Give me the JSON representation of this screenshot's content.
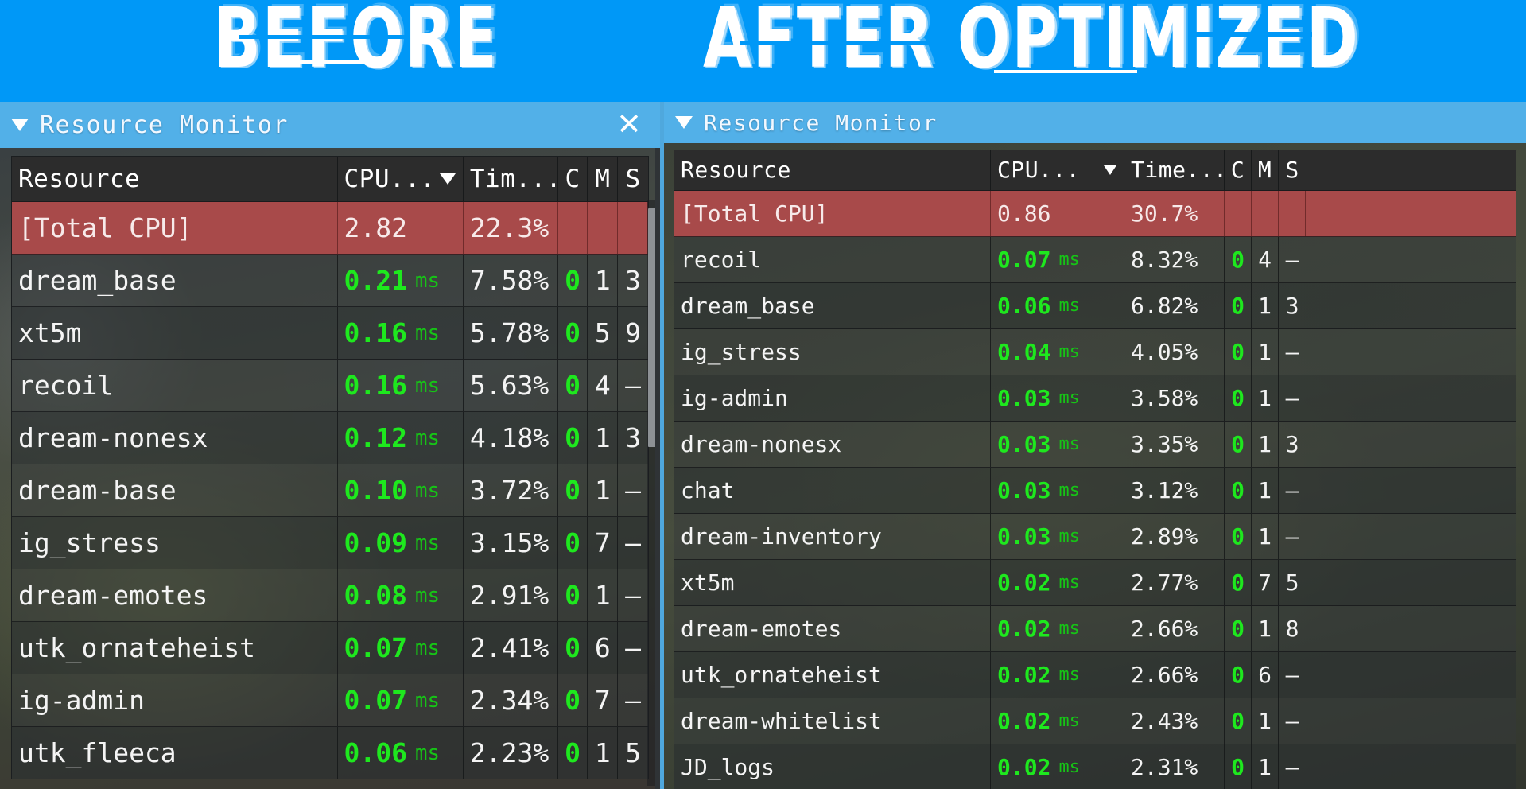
{
  "banner": {
    "left_label": "BEFORE",
    "right_label": "AFTER OPTIMIZED",
    "background_color": "#0098f7",
    "text_color": "#ffffff"
  },
  "colors": {
    "titlebar": "#52b0e8",
    "header_row": "#2c2c2c",
    "total_row": "#a84a4a",
    "ms_green": "#1ee81e",
    "text": "#f4f4f4"
  },
  "panels": {
    "before": {
      "title": "Resource Monitor",
      "collapse_icon": "triangle-down-icon",
      "close_icon": "close-icon",
      "columns": [
        "Resource",
        "CPU...",
        "Tim...",
        "C",
        "M",
        "S"
      ],
      "sorted_column": "CPU...",
      "sort_direction": "descending",
      "rows": [
        {
          "resource": "[Total CPU]",
          "cpu": "2.82",
          "unit": "",
          "time": "22.3%",
          "c": "",
          "m": "",
          "s": "",
          "total": true
        },
        {
          "resource": "dream_base",
          "cpu": "0.21",
          "unit": "ms",
          "time": "7.58%",
          "c": "0",
          "m": "1",
          "s": "3"
        },
        {
          "resource": "xt5m",
          "cpu": "0.16",
          "unit": "ms",
          "time": "5.78%",
          "c": "0",
          "m": "5",
          "s": "9"
        },
        {
          "resource": "recoil",
          "cpu": "0.16",
          "unit": "ms",
          "time": "5.63%",
          "c": "0",
          "m": "4",
          "s": "—"
        },
        {
          "resource": "dream-nonesx",
          "cpu": "0.12",
          "unit": "ms",
          "time": "4.18%",
          "c": "0",
          "m": "1",
          "s": "3"
        },
        {
          "resource": "dream-base",
          "cpu": "0.10",
          "unit": "ms",
          "time": "3.72%",
          "c": "0",
          "m": "1",
          "s": "—"
        },
        {
          "resource": "ig_stress",
          "cpu": "0.09",
          "unit": "ms",
          "time": "3.15%",
          "c": "0",
          "m": "7",
          "s": "—"
        },
        {
          "resource": "dream-emotes",
          "cpu": "0.08",
          "unit": "ms",
          "time": "2.91%",
          "c": "0",
          "m": "1",
          "s": "—"
        },
        {
          "resource": "utk_ornateheist",
          "cpu": "0.07",
          "unit": "ms",
          "time": "2.41%",
          "c": "0",
          "m": "6",
          "s": "—"
        },
        {
          "resource": "ig-admin",
          "cpu": "0.07",
          "unit": "ms",
          "time": "2.34%",
          "c": "0",
          "m": "7",
          "s": "—"
        },
        {
          "resource": "utk_fleeca",
          "cpu": "0.06",
          "unit": "ms",
          "time": "2.23%",
          "c": "0",
          "m": "1",
          "s": "5"
        }
      ]
    },
    "after": {
      "title": "Resource Monitor",
      "collapse_icon": "triangle-down-icon",
      "columns": [
        "Resource",
        "CPU...",
        "Time...",
        "C",
        "M",
        "S"
      ],
      "sorted_column": "CPU...",
      "sort_direction": "descending",
      "rows": [
        {
          "resource": "[Total CPU]",
          "cpu": "0.86",
          "unit": "",
          "time": "30.7%",
          "c": "",
          "m": "",
          "s": "",
          "total": true
        },
        {
          "resource": "recoil",
          "cpu": "0.07",
          "unit": "ms",
          "time": "8.32%",
          "c": "0",
          "m": "4",
          "s": "—"
        },
        {
          "resource": "dream_base",
          "cpu": "0.06",
          "unit": "ms",
          "time": "6.82%",
          "c": "0",
          "m": "1",
          "s": "3"
        },
        {
          "resource": "ig_stress",
          "cpu": "0.04",
          "unit": "ms",
          "time": "4.05%",
          "c": "0",
          "m": "1",
          "s": "—"
        },
        {
          "resource": "ig-admin",
          "cpu": "0.03",
          "unit": "ms",
          "time": "3.58%",
          "c": "0",
          "m": "1",
          "s": "—"
        },
        {
          "resource": "dream-nonesx",
          "cpu": "0.03",
          "unit": "ms",
          "time": "3.35%",
          "c": "0",
          "m": "1",
          "s": "3"
        },
        {
          "resource": "chat",
          "cpu": "0.03",
          "unit": "ms",
          "time": "3.12%",
          "c": "0",
          "m": "1",
          "s": "—"
        },
        {
          "resource": "dream-inventory",
          "cpu": "0.03",
          "unit": "ms",
          "time": "2.89%",
          "c": "0",
          "m": "1",
          "s": "—"
        },
        {
          "resource": "xt5m",
          "cpu": "0.02",
          "unit": "ms",
          "time": "2.77%",
          "c": "0",
          "m": "7",
          "s": "5"
        },
        {
          "resource": "dream-emotes",
          "cpu": "0.02",
          "unit": "ms",
          "time": "2.66%",
          "c": "0",
          "m": "1",
          "s": "8"
        },
        {
          "resource": "utk_ornateheist",
          "cpu": "0.02",
          "unit": "ms",
          "time": "2.66%",
          "c": "0",
          "m": "6",
          "s": "—"
        },
        {
          "resource": "dream-whitelist",
          "cpu": "0.02",
          "unit": "ms",
          "time": "2.43%",
          "c": "0",
          "m": "1",
          "s": "—"
        },
        {
          "resource": "JD_logs",
          "cpu": "0.02",
          "unit": "ms",
          "time": "2.31%",
          "c": "0",
          "m": "1",
          "s": "—"
        }
      ]
    }
  }
}
